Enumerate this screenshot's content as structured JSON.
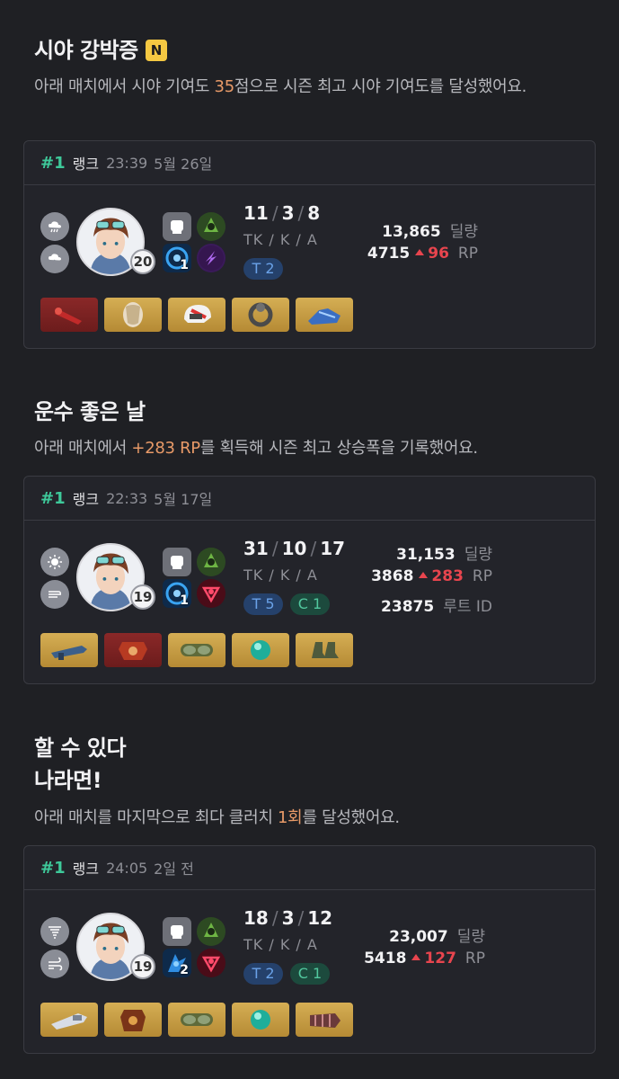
{
  "sections": [
    {
      "title": "시야 강박증",
      "badge": "N",
      "desc_pre": "아래 매치에서 시야 기여도 ",
      "desc_hl": "35",
      "desc_post": "점으로 시즌 최고 시야 기여도를 달성했어요.",
      "match": {
        "rank": "#1",
        "mode": "랭크",
        "time": "23:39",
        "date": "5월 26일",
        "level": "20",
        "skill_level": "1",
        "kda": {
          "k": "11",
          "d": "3",
          "a": "8",
          "label": "TK / K / A"
        },
        "tags": [
          "T 2"
        ],
        "stats": [
          {
            "value": "13,865",
            "unit": "딜량"
          },
          {
            "value": "4715",
            "delta": "96",
            "unit": "RP"
          }
        ],
        "items": [
          "weapon-item",
          "armor-item",
          "helmet-item",
          "ring-item",
          "boots-item"
        ]
      }
    },
    {
      "title": "운수 좋은 날",
      "desc_pre": "아래 매치에서 ",
      "desc_hl": "+283 RP",
      "desc_post": "를 획득해 시즌 최고 상승폭을 기록했어요.",
      "match": {
        "rank": "#1",
        "mode": "랭크",
        "time": "22:33",
        "date": "5월 17일",
        "level": "19",
        "skill_level": "1",
        "kda": {
          "k": "31",
          "d": "10",
          "a": "17",
          "label": "TK / K / A"
        },
        "tags": [
          "T 5",
          "C 1"
        ],
        "stats": [
          {
            "value": "31,153",
            "unit": "딜량"
          },
          {
            "value": "3868",
            "delta": "283",
            "unit": "RP"
          },
          {
            "value": "23875",
            "unit": "루트 ID"
          }
        ],
        "items": [
          "weapon-item",
          "armor-item",
          "goggles-item",
          "orb-item",
          "boots-item"
        ]
      }
    },
    {
      "title": "할 수 있다",
      "title2": "나라면!",
      "desc_pre": "아래 매치를 마지막으로 최다 클러치 ",
      "desc_hl": "1회",
      "desc_post": "를 달성했어요.",
      "match": {
        "rank": "#1",
        "mode": "랭크",
        "time": "24:05",
        "date": "2일 전",
        "level": "19",
        "skill_level": "2",
        "kda": {
          "k": "18",
          "d": "3",
          "a": "12",
          "label": "TK / K / A"
        },
        "tags": [
          "T 2",
          "C 1"
        ],
        "stats": [
          {
            "value": "23,007",
            "unit": "딜량"
          },
          {
            "value": "5418",
            "delta": "127",
            "unit": "RP"
          }
        ],
        "items": [
          "weapon-item",
          "armor-item",
          "goggles-item",
          "orb-item",
          "gauntlet-item"
        ]
      }
    }
  ],
  "colors": {
    "accent_green": "#3ec99a",
    "highlight_orange": "#e89a68",
    "rp_up_red": "#e8454e",
    "item_gold": "#c9a045",
    "item_red": "#7c2222"
  }
}
